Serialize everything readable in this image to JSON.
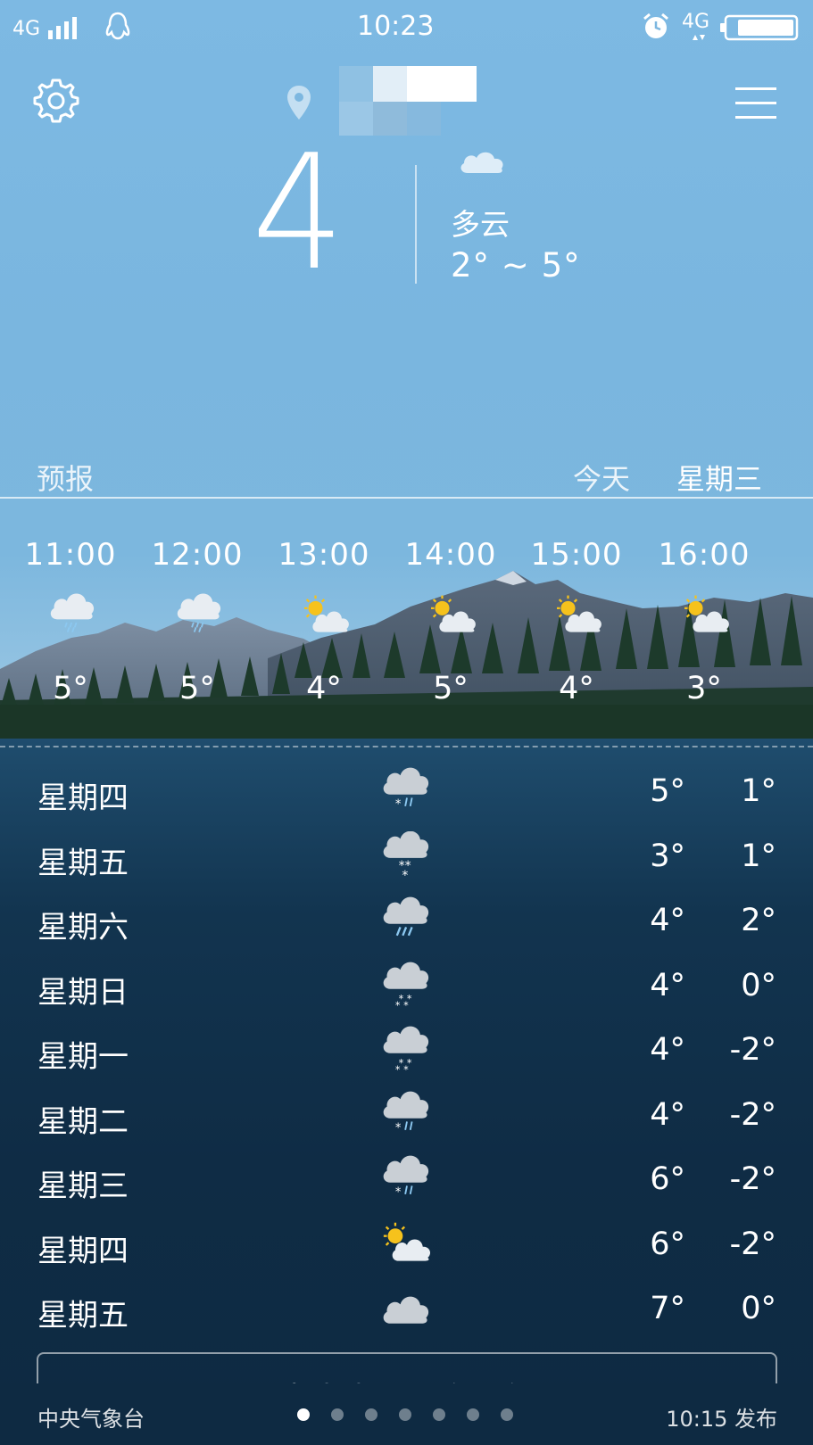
{
  "status_bar": {
    "network_left": "4G",
    "time": "10:23",
    "network_right": "4G"
  },
  "current": {
    "temperature": "4",
    "condition": "多云",
    "range": "2° ~ 5°"
  },
  "forecast_header": {
    "label": "预报",
    "today": "今天",
    "weekday": "星期三"
  },
  "hourly": [
    {
      "time": "11:00",
      "temp": "5°",
      "icon": "rain-cloud-icon"
    },
    {
      "time": "12:00",
      "temp": "5°",
      "icon": "rain-cloud-icon"
    },
    {
      "time": "13:00",
      "temp": "4°",
      "icon": "partly-cloudy-icon"
    },
    {
      "time": "14:00",
      "temp": "5°",
      "icon": "partly-cloudy-icon"
    },
    {
      "time": "15:00",
      "temp": "4°",
      "icon": "partly-cloudy-icon"
    },
    {
      "time": "16:00",
      "temp": "3°",
      "icon": "partly-cloudy-icon"
    }
  ],
  "daily": [
    {
      "day": "星期四",
      "icon": "sleet-icon",
      "high": "5°",
      "low": "1°"
    },
    {
      "day": "星期五",
      "icon": "snow-icon",
      "high": "3°",
      "low": "1°"
    },
    {
      "day": "星期六",
      "icon": "rain-icon",
      "high": "4°",
      "low": "2°"
    },
    {
      "day": "星期日",
      "icon": "light-snow-icon",
      "high": "4°",
      "low": "0°"
    },
    {
      "day": "星期一",
      "icon": "light-snow-icon",
      "high": "4°",
      "low": "-2°"
    },
    {
      "day": "星期二",
      "icon": "sleet-icon",
      "high": "4°",
      "low": "-2°"
    },
    {
      "day": "星期三",
      "icon": "sleet-icon",
      "high": "6°",
      "low": "-2°"
    },
    {
      "day": "星期四",
      "icon": "partly-cloudy-icon",
      "high": "6°",
      "low": "-2°"
    },
    {
      "day": "星期五",
      "icon": "cloudy-icon",
      "high": "7°",
      "low": "0°"
    }
  ],
  "more_button": "点击查看更多天气",
  "footer": {
    "source": "中央气象台",
    "published": "10:15 发布",
    "page_count": 7,
    "active_page": 1
  }
}
